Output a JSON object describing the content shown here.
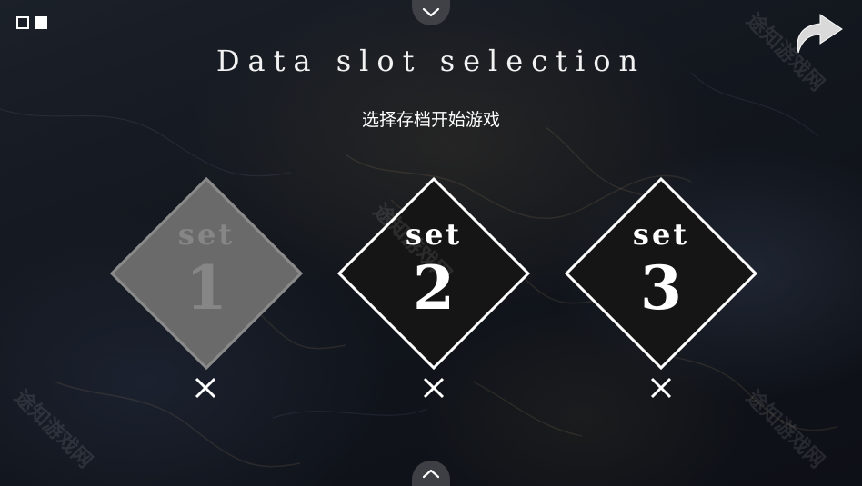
{
  "header": {
    "title": "Data slot selection",
    "subtitle": "选择存档开始游戏"
  },
  "page_indicator": {
    "pages": 2,
    "current_page": 2
  },
  "slots": [
    {
      "word": "set",
      "number": "1",
      "state": "disabled",
      "color": "#6a6a6a"
    },
    {
      "word": "set",
      "number": "2",
      "state": "active",
      "color": "#151515"
    },
    {
      "word": "set",
      "number": "3",
      "state": "active",
      "color": "#151515"
    }
  ],
  "watermark": {
    "text": "途知游戏网"
  },
  "icons": {
    "top_tab": "chevron-down-icon",
    "bottom_tab": "chevron-up-icon",
    "back": "return-arrow-icon",
    "delete": "close-icon"
  },
  "colors": {
    "text": "#ffffff",
    "disabled_slot": "#6a6a6a",
    "active_slot": "#151515",
    "tab_bg": "#46484e"
  }
}
